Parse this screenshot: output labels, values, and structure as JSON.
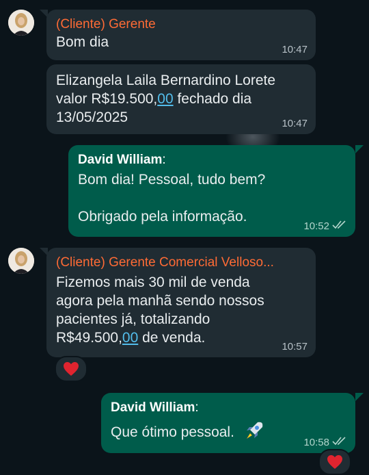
{
  "messages": [
    {
      "sender": "(Cliente) Gerente",
      "text": "Bom dia",
      "time": "10:47"
    },
    {
      "text_part1": "Elizangela Laila Bernardino Lorete",
      "text_part2": "valor R$19.500,",
      "text_link": "00",
      "text_part3": " fechado dia",
      "text_part4": "13/05/2025",
      "time": "10:47"
    },
    {
      "sender": "David William",
      "sender_colon": ":",
      "line1": "Bom dia! Pessoal, tudo bem?",
      "line2": "Obrigado pela informação.",
      "time": "10:52"
    },
    {
      "sender": "(Cliente) Gerente Comercial Velloso...",
      "line1": "Fizemos mais 30 mil de venda",
      "line2": "agora pela manhã sendo nossos",
      "line3": "pacientes já, totalizando",
      "line4_part1": "R$49.500,",
      "line4_link": "00",
      "line4_part2": " de venda.",
      "time": "10:57",
      "reaction": "heart"
    },
    {
      "sender": "David William",
      "sender_colon": ":",
      "text": "Que ótimo pessoal.",
      "emoji": "rocket",
      "time": "10:58",
      "reaction": "heart"
    }
  ],
  "colors": {
    "background": "#0b141a",
    "incoming_bubble": "#202c33",
    "outgoing_bubble": "#005c4b",
    "client_sender": "#ff6b35",
    "link": "#53bdeb"
  },
  "icons": {
    "read_receipt": "double-check-icon",
    "reaction": "heart-icon",
    "avatar": "contact-avatar"
  }
}
